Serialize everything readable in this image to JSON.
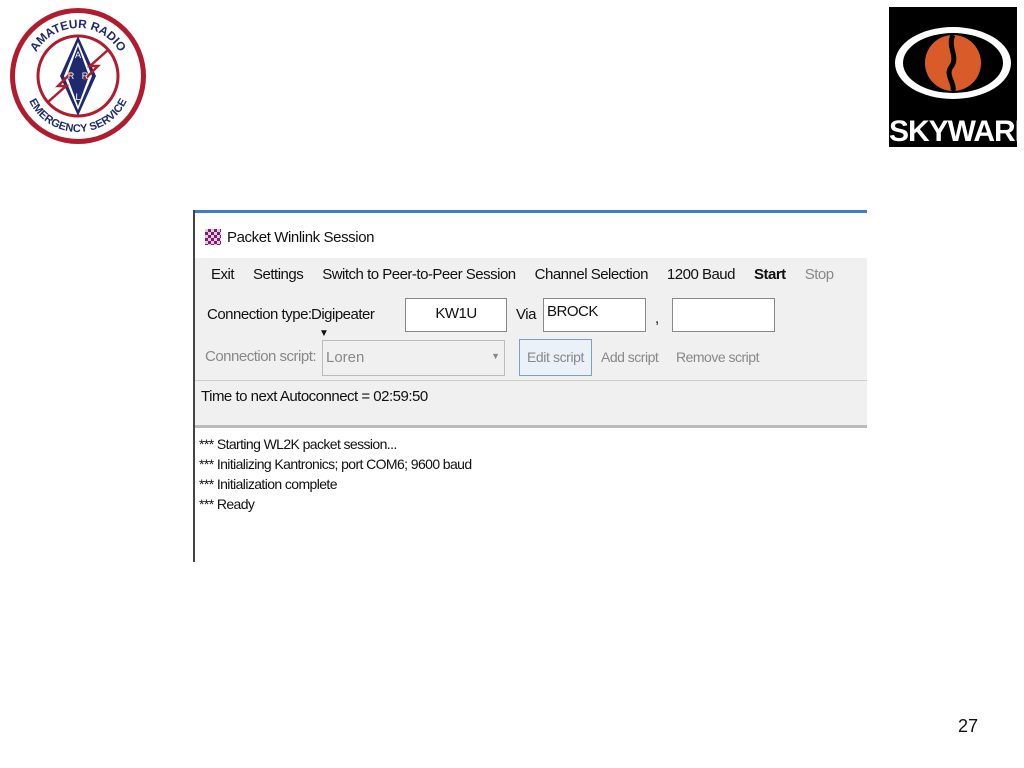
{
  "logos": {
    "ares_text": "AMATEUR RADIO EMERGENCY SERVICE",
    "ares_letters": [
      "A",
      "R",
      "R",
      "L"
    ],
    "skywarn_text": "SKYWARN"
  },
  "window": {
    "title": "Packet Winlink Session",
    "menu": [
      "Exit",
      "Settings",
      "Switch to Peer-to-Peer Session",
      "Channel Selection",
      "1200 Baud",
      "Start",
      "Stop"
    ],
    "connection_type_label": "Connection type:",
    "connection_type_value": "Digipeater",
    "callsign": "KW1U",
    "via_label": "Via",
    "via_value": "BROCK",
    "comma": ",",
    "via2_value": "",
    "connection_script_label": "Connection script:",
    "connection_script_value": "Loren",
    "edit_script": "Edit script",
    "add_script": "Add script",
    "remove_script": "Remove script",
    "status": "Time to next Autoconnect = 02:59:50",
    "log": [
      "*** Starting WL2K packet session...",
      "*** Initializing Kantronics; port COM6; 9600 baud",
      "*** Initialization complete",
      "*** Ready"
    ]
  },
  "slide": {
    "page_number": "27"
  },
  "colors": {
    "ares_ring": "#b01c2e",
    "ares_navy": "#1f2a6e",
    "skywarn_orange": "#d95b2a"
  }
}
